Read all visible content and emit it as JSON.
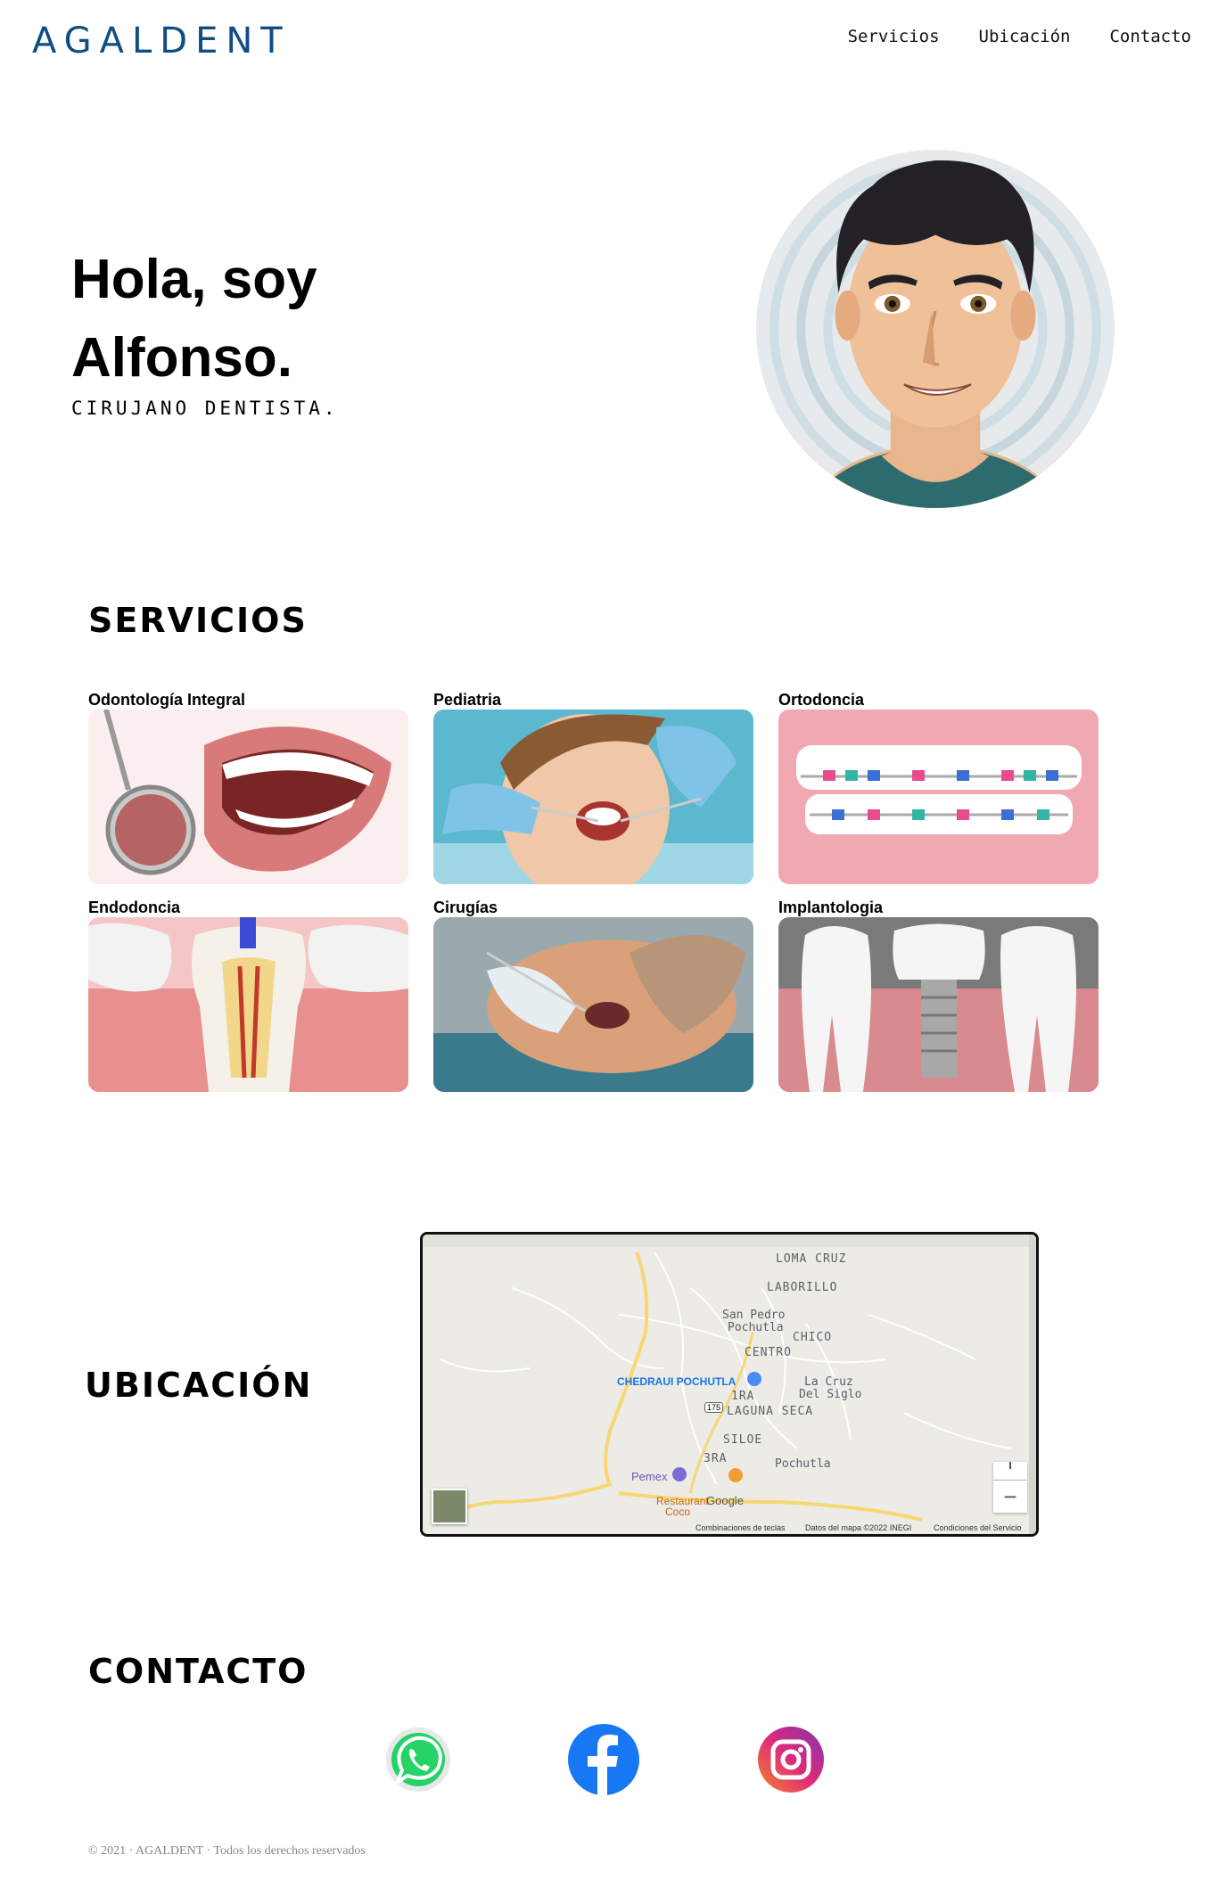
{
  "header": {
    "logo": "AGALDENT",
    "nav": [
      "Servicios",
      "Ubicación",
      "Contacto"
    ]
  },
  "hero": {
    "title_line1": "Hola, soy",
    "title_line2": "Alfonso.",
    "subtitle": "CIRUJANO DENTISTA."
  },
  "services": {
    "title": "SERVICIOS",
    "items": [
      {
        "label": "Odontología Integral"
      },
      {
        "label": "Pediatria"
      },
      {
        "label": "Ortodoncia"
      },
      {
        "label": "Endodoncia"
      },
      {
        "label": "Cirugías"
      },
      {
        "label": "Implantologia"
      }
    ]
  },
  "location": {
    "title": "UBICACIÓN",
    "map": {
      "labels": [
        "LOMA CRUZ",
        "LABORILLO",
        "San Pedro",
        "Pochutla",
        "CHICO",
        "CENTRO",
        "La Cruz",
        "Del Siglo",
        "1RA",
        "LAGUNA SECA",
        "SILOE",
        "3RA",
        "Pochutla"
      ],
      "poi_chedraui": "CHEDRAUI POCHUTLA",
      "poi_pemex": "Pemex",
      "poi_restaurant": "Restaurant",
      "poi_coco": "Coco",
      "road_number": "175",
      "google": "Google",
      "footer_shortcuts": "Combinaciones de teclas",
      "footer_data": "Datos del mapa ©2022 INEGI",
      "footer_terms": "Condiciones del Servicio",
      "zoom_out": "−"
    }
  },
  "contact": {
    "title": "CONTACTO",
    "icons": [
      "whatsapp-icon",
      "facebook-icon",
      "instagram-icon"
    ]
  },
  "footer": {
    "text": "© 2021 · AGALDENT · Todos los derechos reservados"
  },
  "colors": {
    "logo": "#0f4e85",
    "facebook": "#1877f2",
    "whatsapp": "#25d366"
  }
}
